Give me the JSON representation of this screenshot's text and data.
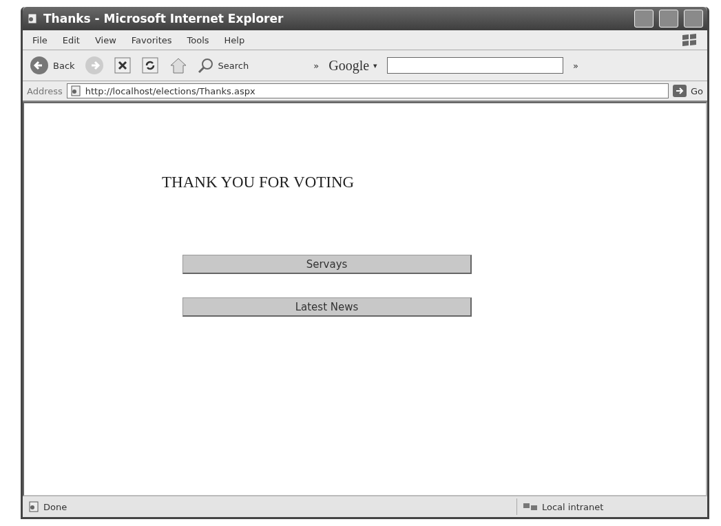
{
  "window": {
    "title": "Thanks - Microsoft Internet Explorer"
  },
  "menu": [
    "File",
    "Edit",
    "View",
    "Favorites",
    "Tools",
    "Help"
  ],
  "toolbar": {
    "back": "Back",
    "search": "Search",
    "chevron": "»",
    "google": "Google",
    "google_caret": "▾",
    "google_chevron": "»"
  },
  "address": {
    "label": "Address",
    "url": "http://localhost/elections/Thanks.aspx",
    "go": "Go"
  },
  "page": {
    "heading": "THANK YOU FOR VOTING",
    "buttons": [
      "Servays",
      "Latest News"
    ]
  },
  "status_bar": {
    "text": "Done",
    "zone": "Local intranet"
  }
}
